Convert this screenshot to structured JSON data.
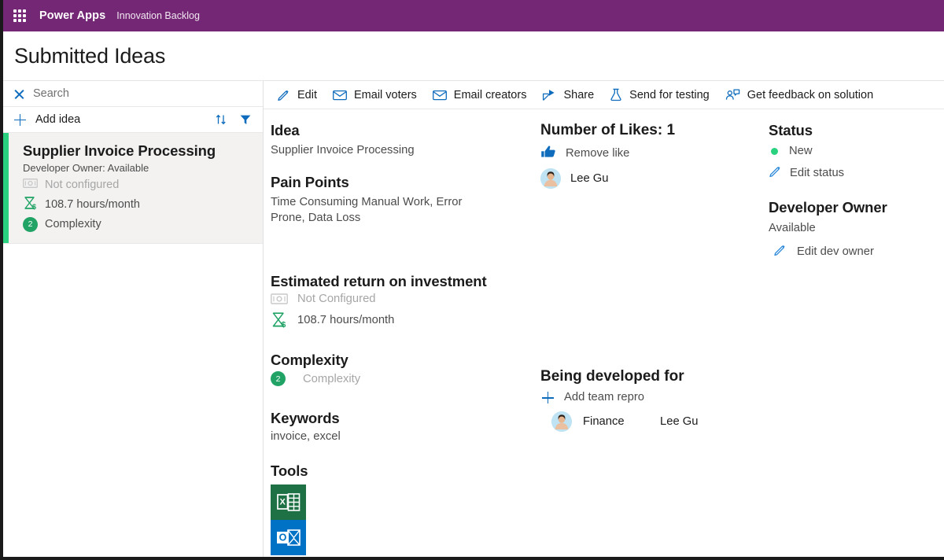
{
  "topbar": {
    "waffle_icon": "waffle-grid-icon",
    "brand": "Power Apps",
    "app_name": "Innovation Backlog"
  },
  "page": {
    "title": "Submitted Ideas"
  },
  "sidebar": {
    "search": {
      "clear_icon": "close-icon",
      "placeholder": "Search",
      "value": ""
    },
    "add": {
      "plus_icon": "plus-icon",
      "label": "Add idea",
      "sort_icon": "sort-icon",
      "filter_icon": "filter-icon"
    },
    "ideas": [
      {
        "title": "Supplier Invoice Processing",
        "owner": "Developer Owner: Available",
        "money_icon": "money-icon",
        "money_value": "Not configured",
        "hours_icon": "hourglass-dollar-icon",
        "hours_value": "108.7 hours/month",
        "complexity_badge": "2",
        "complexity_label": "Complexity",
        "accent_color": "#2ad17e",
        "selected": true
      }
    ]
  },
  "commandbar": {
    "commands": [
      {
        "icon": "pencil-icon",
        "label": "Edit"
      },
      {
        "icon": "mail-icon",
        "label": "Email voters"
      },
      {
        "icon": "mail-icon",
        "label": "Email creators"
      },
      {
        "icon": "share-icon",
        "label": "Share"
      },
      {
        "icon": "flask-icon",
        "label": "Send for testing"
      },
      {
        "icon": "feedback-person-icon",
        "label": "Get feedback on solution"
      }
    ]
  },
  "details": {
    "idea": {
      "heading": "Idea",
      "value": "Supplier Invoice Processing"
    },
    "pain_points": {
      "heading": "Pain Points",
      "value": "Time Consuming Manual Work, Error Prone, Data Loss"
    },
    "roi": {
      "heading": "Estimated return on investment",
      "money_icon": "money-icon",
      "money_value": "Not Configured",
      "hours_icon": "hourglass-dollar-icon",
      "hours_value": "108.7 hours/month"
    },
    "complexity": {
      "heading": "Complexity",
      "badge": "2",
      "label": "Complexity"
    },
    "keywords": {
      "heading": "Keywords",
      "value": "invoice, excel"
    },
    "tools": {
      "heading": "Tools",
      "items": [
        {
          "icon": "excel-icon",
          "name": "Excel",
          "color": "#1e7145"
        },
        {
          "icon": "outlook-icon",
          "name": "Outlook",
          "color": "#0072c6"
        }
      ]
    }
  },
  "likes": {
    "heading": "Number of Likes: 1",
    "count": "1",
    "action_icon": "thumbs-up-icon",
    "action_label": "Remove like",
    "voters": [
      {
        "avatar": "person-avatar",
        "name": "Lee Gu"
      }
    ]
  },
  "developed_for": {
    "heading": "Being developed for",
    "add_icon": "plus-icon",
    "add_label": "Add team repro",
    "teams": [
      {
        "avatar": "person-avatar",
        "team": "Finance",
        "person": "Lee Gu"
      }
    ]
  },
  "status": {
    "heading": "Status",
    "dot_color": "#2ad17e",
    "value": "New",
    "edit_icon": "pencil-icon",
    "edit_label": "Edit status"
  },
  "developer_owner": {
    "heading": "Developer Owner",
    "value": "Available",
    "edit_icon": "pencil-icon",
    "edit_label": "Edit dev owner"
  },
  "colors": {
    "brand_purple": "#742774",
    "accent_blue": "#0f6cbd",
    "accent_green": "#2ad17e",
    "badge_green": "#21a366"
  }
}
